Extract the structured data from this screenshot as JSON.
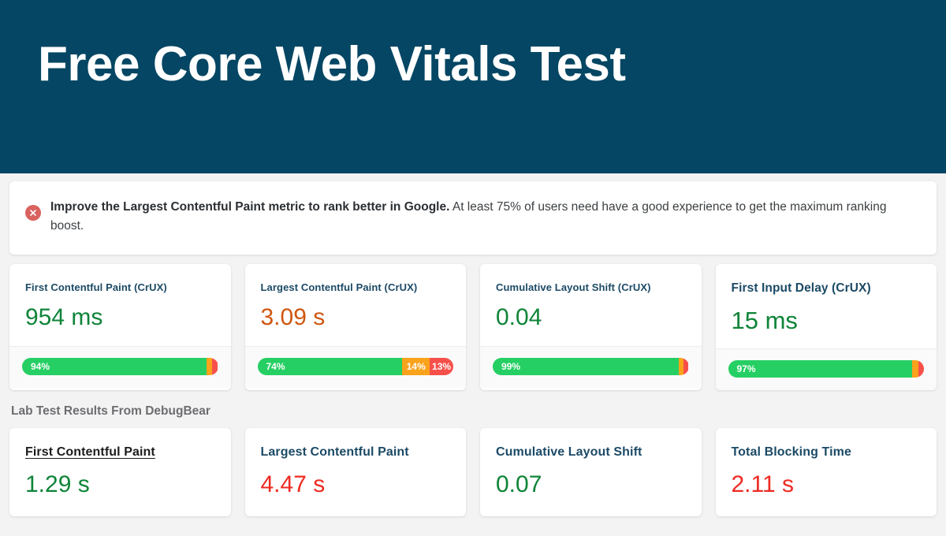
{
  "header": {
    "title": "Free Core Web Vitals Test",
    "background_color": "#044663"
  },
  "alert": {
    "icon": "error-circle-icon",
    "icon_color": "#d9625f",
    "bold_text": "Improve the Largest Contentful Paint metric to rank better in Google.",
    "rest_text": " At least 75% of users need have a good experience to get the maximum ranking boost."
  },
  "crux_section": {
    "cards": [
      {
        "title": "First Contentful Paint (CrUX)",
        "value": "954 ms",
        "value_status": "good",
        "segments": [
          {
            "label": "94%",
            "status": "good",
            "pct": 94
          },
          {
            "label": "",
            "status": "warn",
            "pct": 3
          },
          {
            "label": "",
            "status": "bad",
            "pct": 3
          }
        ]
      },
      {
        "title": "Largest Contentful Paint (CrUX)",
        "value": "3.09 s",
        "value_status": "warn",
        "segments": [
          {
            "label": "74%",
            "status": "good",
            "pct": 74
          },
          {
            "label": "14%",
            "status": "warn",
            "pct": 14
          },
          {
            "label": "13%",
            "status": "bad",
            "pct": 12
          }
        ]
      },
      {
        "title": "Cumulative Layout Shift (CrUX)",
        "value": "0.04",
        "value_status": "good",
        "segments": [
          {
            "label": "99%",
            "status": "good",
            "pct": 95
          },
          {
            "label": "",
            "status": "warn",
            "pct": 2.5
          },
          {
            "label": "",
            "status": "bad",
            "pct": 2.5
          }
        ]
      },
      {
        "title": "First Input Delay (CrUX)",
        "value": "15 ms",
        "value_status": "good",
        "segments": [
          {
            "label": "97%",
            "status": "good",
            "pct": 94
          },
          {
            "label": "",
            "status": "warn",
            "pct": 3
          },
          {
            "label": "",
            "status": "bad",
            "pct": 3
          }
        ]
      }
    ]
  },
  "lab_section": {
    "heading": "Lab Test Results From DebugBear",
    "cards": [
      {
        "title": "First Contentful Paint",
        "value": "1.29 s",
        "value_status": "good",
        "hovered": true
      },
      {
        "title": "Largest Contentful Paint",
        "value": "4.47 s",
        "value_status": "bad",
        "hovered": false
      },
      {
        "title": "Cumulative Layout Shift",
        "value": "0.07",
        "value_status": "good",
        "hovered": false
      },
      {
        "title": "Total Blocking Time",
        "value": "2.11 s",
        "value_status": "bad",
        "hovered": false
      }
    ]
  },
  "colors": {
    "good": "#26cf63",
    "warn": "#f9a21b",
    "bad": "#f7504a",
    "value_good": "#0f8438",
    "value_warn": "#cf5610",
    "value_bad": "#ee2a23",
    "brand_navy": "#1c4a66"
  }
}
